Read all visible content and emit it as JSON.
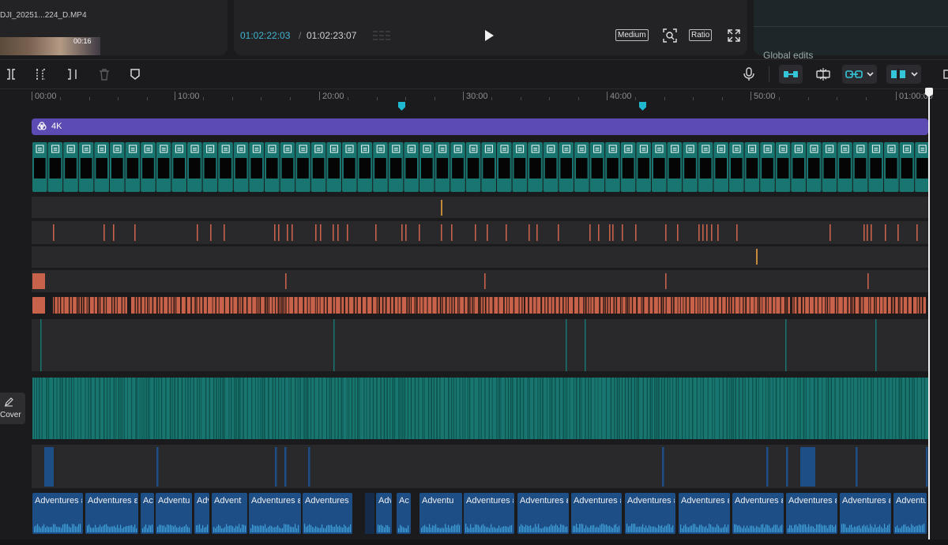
{
  "media": {
    "clip_name": "DJI_20251...224_D.MP4",
    "clip_duration": "00:16"
  },
  "player": {
    "current_time": "01:02:22:03",
    "separator": "/",
    "total_time": "01:02:23:07",
    "quality_label": "Medium",
    "ratio_label": "Ratio"
  },
  "details": {
    "title": "Global edits"
  },
  "ruler": {
    "ticks": [
      "00:00",
      "10:00",
      "20:00",
      "30:00",
      "40:00",
      "50:00",
      "01:00:00"
    ]
  },
  "tracks": {
    "top_clip_label": "4K",
    "audio_clip_labels": [
      "Adventures ε",
      "Adventures ε",
      "Ac",
      "Adventu",
      "Adv",
      "Advent",
      "Adventures ε",
      "Adventures ε",
      "Adv",
      "Ac",
      "Adventu",
      "Adventures ε",
      "Adventures ε",
      "Adventures ε",
      "Adventures ε",
      "Adventures ε",
      "Adventures ε",
      "Adventures ε",
      "Adventures ε",
      "Adventu"
    ]
  },
  "cover": {
    "label": "Cover"
  },
  "colors": {
    "accent": "#3fb4cf",
    "four_k_track": "#5b4bb3",
    "video_clip": "#18756f",
    "marker_orange": "#c8624a",
    "audio_clip": "#1d4e86",
    "playhead": "#f2f2f2"
  },
  "icons": [
    "split-left-icon",
    "split-icon",
    "split-right-icon",
    "delete-icon",
    "shield-icon",
    "microphone-icon",
    "link-icon",
    "freeze-icon",
    "auto-link-icon",
    "snap-icon",
    "play-icon",
    "magnify-icon",
    "fullscreen-icon",
    "cloud-icon",
    "edit-icon"
  ]
}
